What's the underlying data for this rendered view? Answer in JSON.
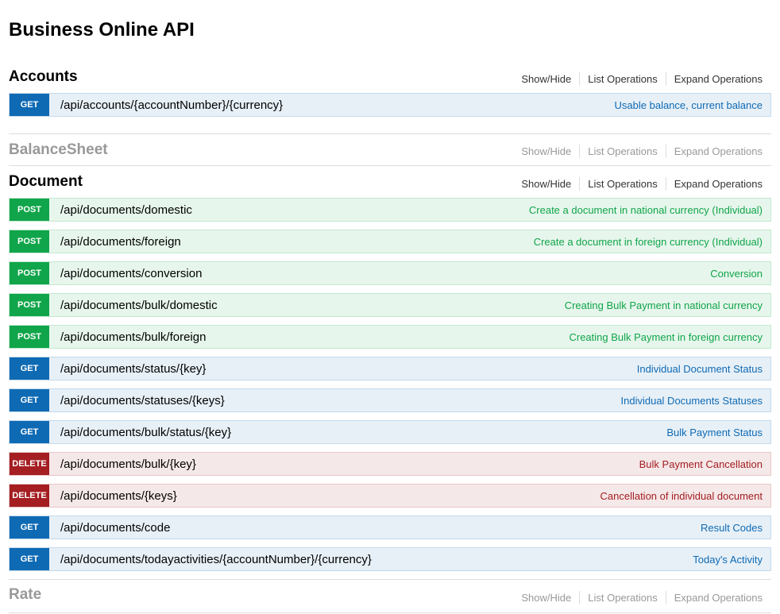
{
  "title": "Business Online API",
  "links": {
    "show_hide": "Show/Hide",
    "list_operations": "List Operations",
    "expand_operations": "Expand Operations"
  },
  "colors": {
    "get": "#0f6ab4",
    "post": "#10a54a",
    "delete": "#a41e22"
  },
  "sections": [
    {
      "name": "Accounts",
      "operations": [
        {
          "method": "GET",
          "path": "/api/accounts/{accountNumber}/{currency}",
          "summary": "Usable balance, current balance"
        }
      ]
    },
    {
      "name": "BalanceSheet",
      "operations": []
    },
    {
      "name": "Document",
      "operations": [
        {
          "method": "POST",
          "path": "/api/documents/domestic",
          "summary": "Create a document in national currency (Individual)"
        },
        {
          "method": "POST",
          "path": "/api/documents/foreign",
          "summary": "Create a document in foreign currency (Individual)"
        },
        {
          "method": "POST",
          "path": "/api/documents/conversion",
          "summary": "Conversion"
        },
        {
          "method": "POST",
          "path": "/api/documents/bulk/domestic",
          "summary": "Creating Bulk Payment in national currency"
        },
        {
          "method": "POST",
          "path": "/api/documents/bulk/foreign",
          "summary": "Creating Bulk Payment in foreign currency"
        },
        {
          "method": "GET",
          "path": "/api/documents/status/{key}",
          "summary": "Individual Document Status"
        },
        {
          "method": "GET",
          "path": "/api/documents/statuses/{keys}",
          "summary": "Individual Documents Statuses"
        },
        {
          "method": "GET",
          "path": "/api/documents/bulk/status/{key}",
          "summary": "Bulk Payment Status"
        },
        {
          "method": "DELETE",
          "path": "/api/documents/bulk/{key}",
          "summary": "Bulk Payment Cancellation"
        },
        {
          "method": "DELETE",
          "path": "/api/documents/{keys}",
          "summary": "Cancellation of individual document"
        },
        {
          "method": "GET",
          "path": "/api/documents/code",
          "summary": "Result Codes"
        },
        {
          "method": "GET",
          "path": "/api/documents/todayactivities/{accountNumber}/{currency}",
          "summary": "Today's Activity"
        }
      ]
    },
    {
      "name": "Rate",
      "operations": []
    }
  ]
}
